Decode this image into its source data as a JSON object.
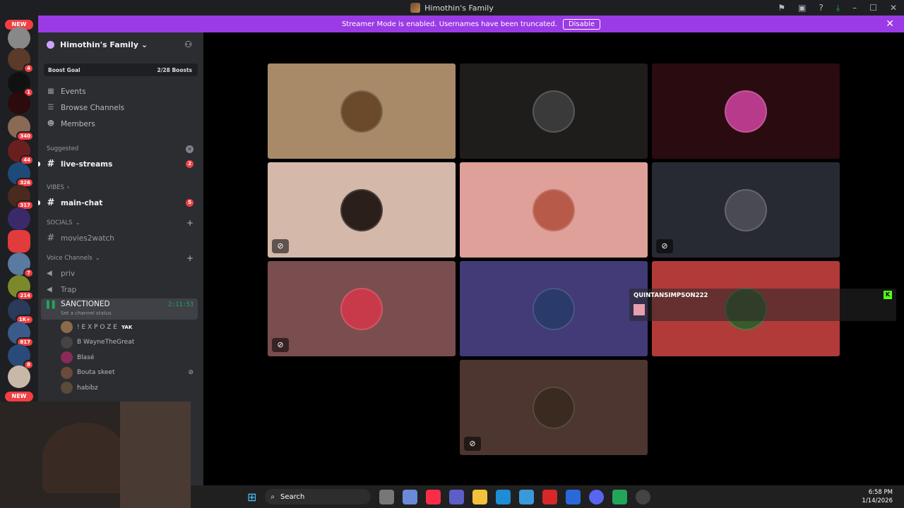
{
  "window": {
    "title": "Himothin's Family"
  },
  "banner": {
    "text": "Streamer Mode is enabled. Usernames have been truncated.",
    "button": "Disable"
  },
  "servers": {
    "new_label_top": "NEW",
    "new_label_bottom": "NEW",
    "badges": [
      "4",
      "1",
      "340",
      "44",
      "326",
      "317",
      "7",
      "214",
      "1K+",
      "817",
      "8"
    ]
  },
  "sidebar": {
    "guild_name": "Himothin's Family",
    "boost_goal": "Boost Goal",
    "boost_count": "2/28 Boosts",
    "menu": [
      "Events",
      "Browse Channels",
      "Members"
    ],
    "suggested": "Suggested",
    "live_streams": {
      "name": "live-streams",
      "count": "2"
    },
    "vibes": "VIBES",
    "main_chat": {
      "name": "main-chat",
      "count": "5"
    },
    "socials": "SOCIALS",
    "movies": "movies2watch",
    "voice_cat": "Voice Channels",
    "voice_channels": [
      "priv",
      "Trap"
    ],
    "active_vc": {
      "name": "SANCTIONED",
      "status": "Set a channel status",
      "time": "2:11:53"
    },
    "voice_users": [
      {
        "name": "! E X P O Z E",
        "tag": "YAK"
      },
      {
        "name": "B WayneTheGreat"
      },
      {
        "name": "Blasé"
      },
      {
        "name": "Bouta skeet"
      },
      {
        "name": "habibz"
      }
    ]
  },
  "overlay": {
    "username": "QUINTANSIMPSON222",
    "badge": "K"
  },
  "taskbar": {
    "search": "Search",
    "time": "6:58 PM",
    "date": "1/14/2026"
  },
  "colors": {
    "accent": "#9b3be6",
    "danger": "#f23f43",
    "online": "#23a559"
  }
}
